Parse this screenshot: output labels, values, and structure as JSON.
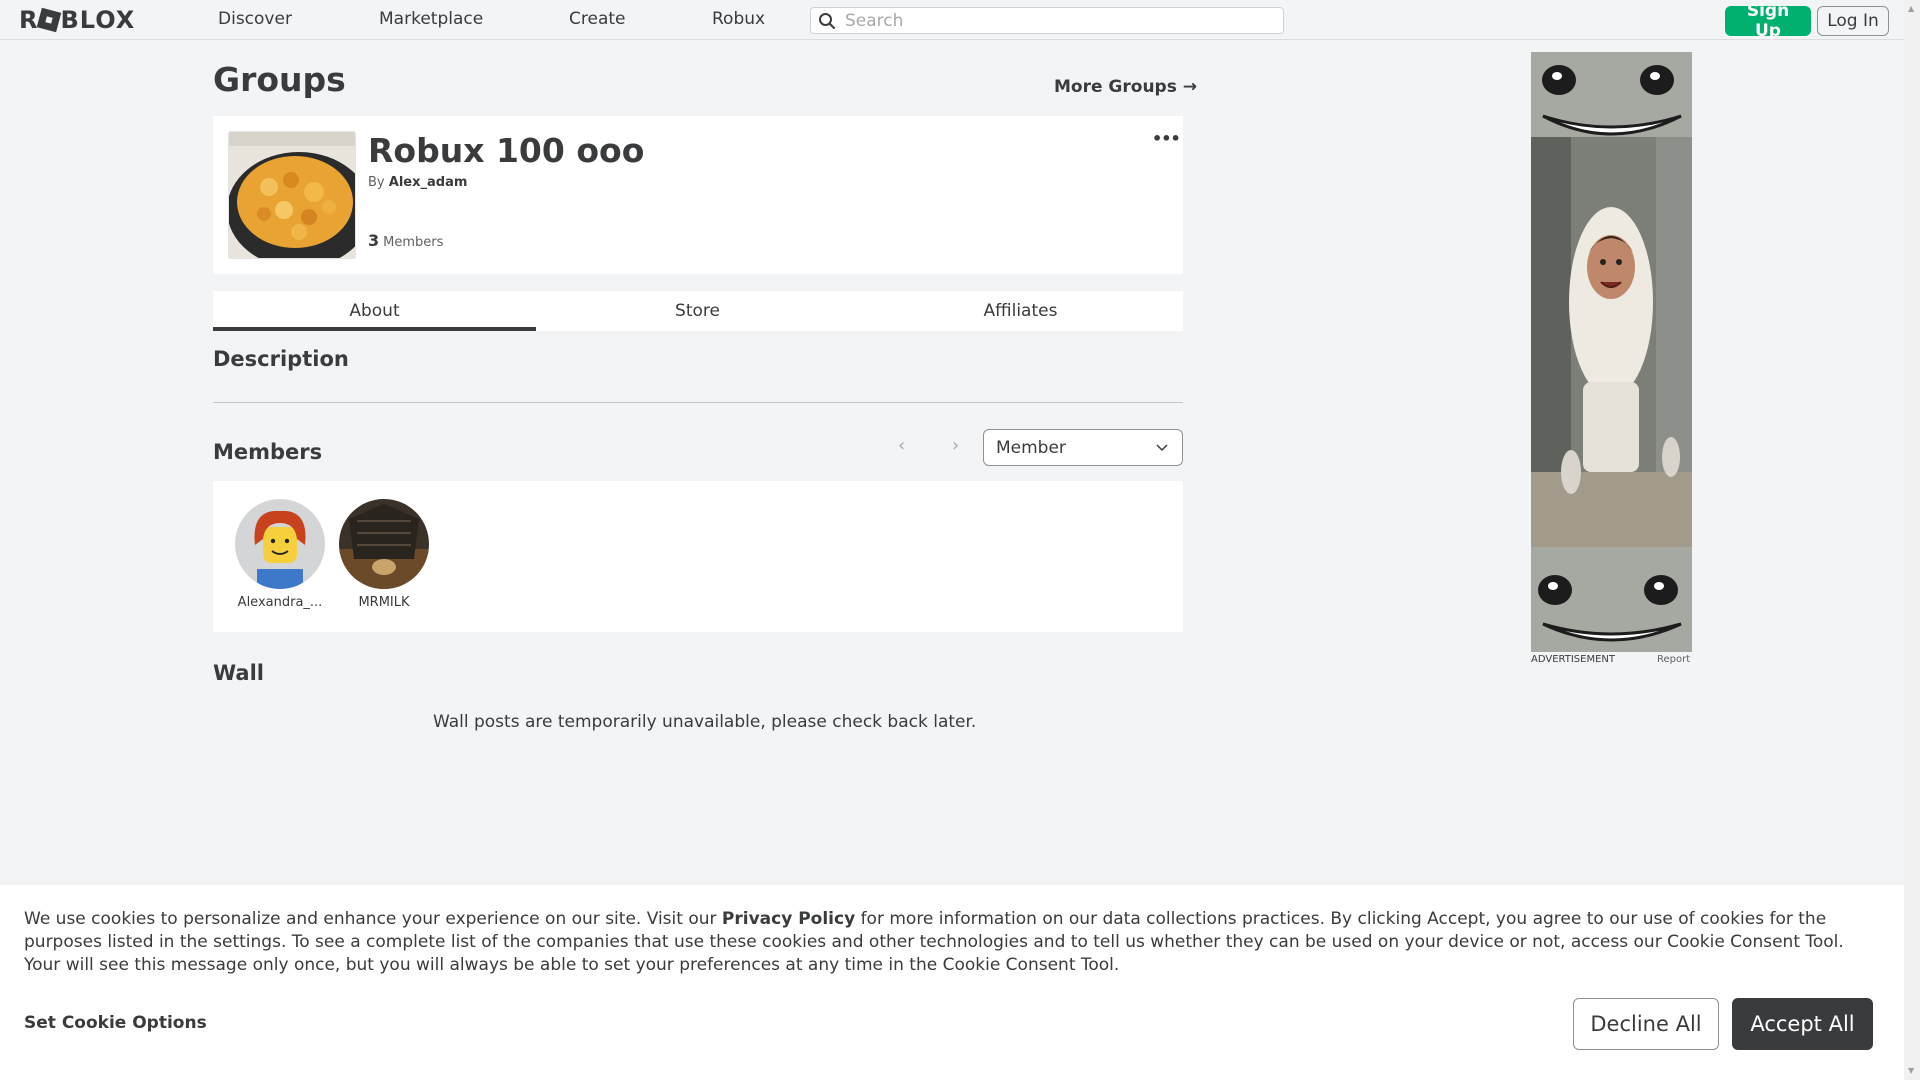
{
  "nav": {
    "logo": "ROBLOX",
    "links": [
      "Discover",
      "Marketplace",
      "Create",
      "Robux"
    ],
    "search_placeholder": "Search",
    "signup_label": "Sign Up",
    "login_label": "Log In"
  },
  "page": {
    "title": "Groups",
    "more_groups_label": "More Groups →"
  },
  "group": {
    "name": "Robux 100 ooo",
    "by_prefix": "By",
    "owner": "Alex_adam",
    "member_count": "3",
    "members_label": "Members",
    "menu_glyph": "•••"
  },
  "tabs": [
    {
      "label": "About",
      "active": true
    },
    {
      "label": "Store",
      "active": false
    },
    {
      "label": "Affiliates",
      "active": false
    }
  ],
  "about": {
    "description_heading": "Description",
    "members_heading": "Members",
    "role_select_value": "Member",
    "members": [
      {
        "name": "Alexandra_..."
      },
      {
        "name": "MRMILK"
      }
    ],
    "wall_heading": "Wall",
    "wall_message": "Wall posts are temporarily unavailable, please check back later."
  },
  "ad": {
    "label": "ADVERTISEMENT",
    "report": "Report"
  },
  "cookie": {
    "text_before": "We use cookies to personalize and enhance your experience on our site. Visit our ",
    "privacy_link": "Privacy Policy",
    "text_after": " for more information on our data collections practices. By clicking Accept, you agree to our use of cookies for the purposes listed in the settings. To see a complete list of the companies that use these cookies and other technologies and to tell us whether they can be used on your device or not, access our Cookie Consent Tool. Your will see this message only once, but you will always be able to set your preferences at any time in the Cookie Consent Tool.",
    "set_options": "Set Cookie Options",
    "decline": "Decline All",
    "accept": "Accept All"
  },
  "colors": {
    "background": "#f2f4f5",
    "text": "#393b3d",
    "signup_green": "#00b06f",
    "accept_dark": "#393b3d"
  }
}
